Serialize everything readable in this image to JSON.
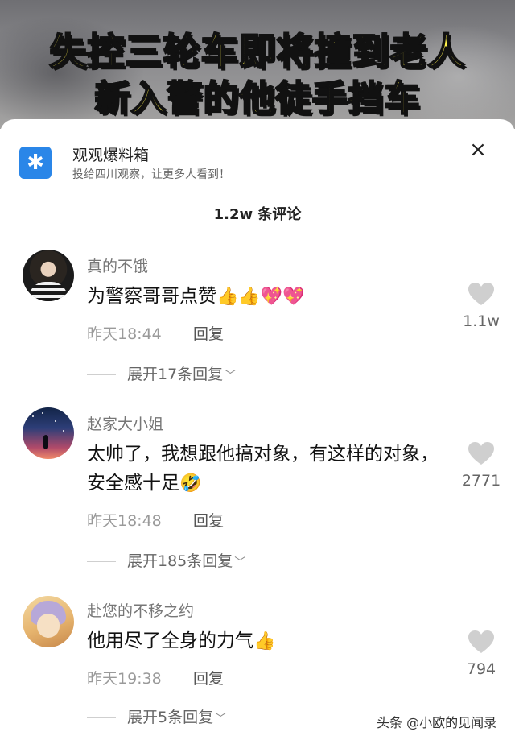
{
  "banner": {
    "line1": "失控三轮车即将撞到老人",
    "line2": "新入警的他徒手挡车",
    "text_color": "#fff24a"
  },
  "source": {
    "icon": "asterisk-icon",
    "name": "观观爆料箱",
    "subtitle": "投给四川观察，让更多人看到！",
    "accent": "#2a86e8"
  },
  "close_icon": "×",
  "comments_header": "1.2w 条评论",
  "comments": [
    {
      "user": "真的不饿",
      "text": "为警察哥哥点赞",
      "emojis": "👍👍💖💖",
      "time": "昨天18:44",
      "reply_label": "回复",
      "expand_label": "展开17条回复",
      "likes": "1.1w"
    },
    {
      "user": "赵家大小姐",
      "text": "太帅了，我想跟他搞对象，有这样的对象，安全感十足",
      "emojis": "🤣",
      "time": "昨天18:48",
      "reply_label": "回复",
      "expand_label": "展开185条回复",
      "likes": "2771"
    },
    {
      "user": "赴您的不移之约",
      "text": "他用尽了全身的力气",
      "emojis": "👍",
      "time": "昨天19:38",
      "reply_label": "回复",
      "expand_label": "展开5条回复",
      "likes": "794"
    }
  ],
  "watermark": "头条 @小欧的见闻录"
}
